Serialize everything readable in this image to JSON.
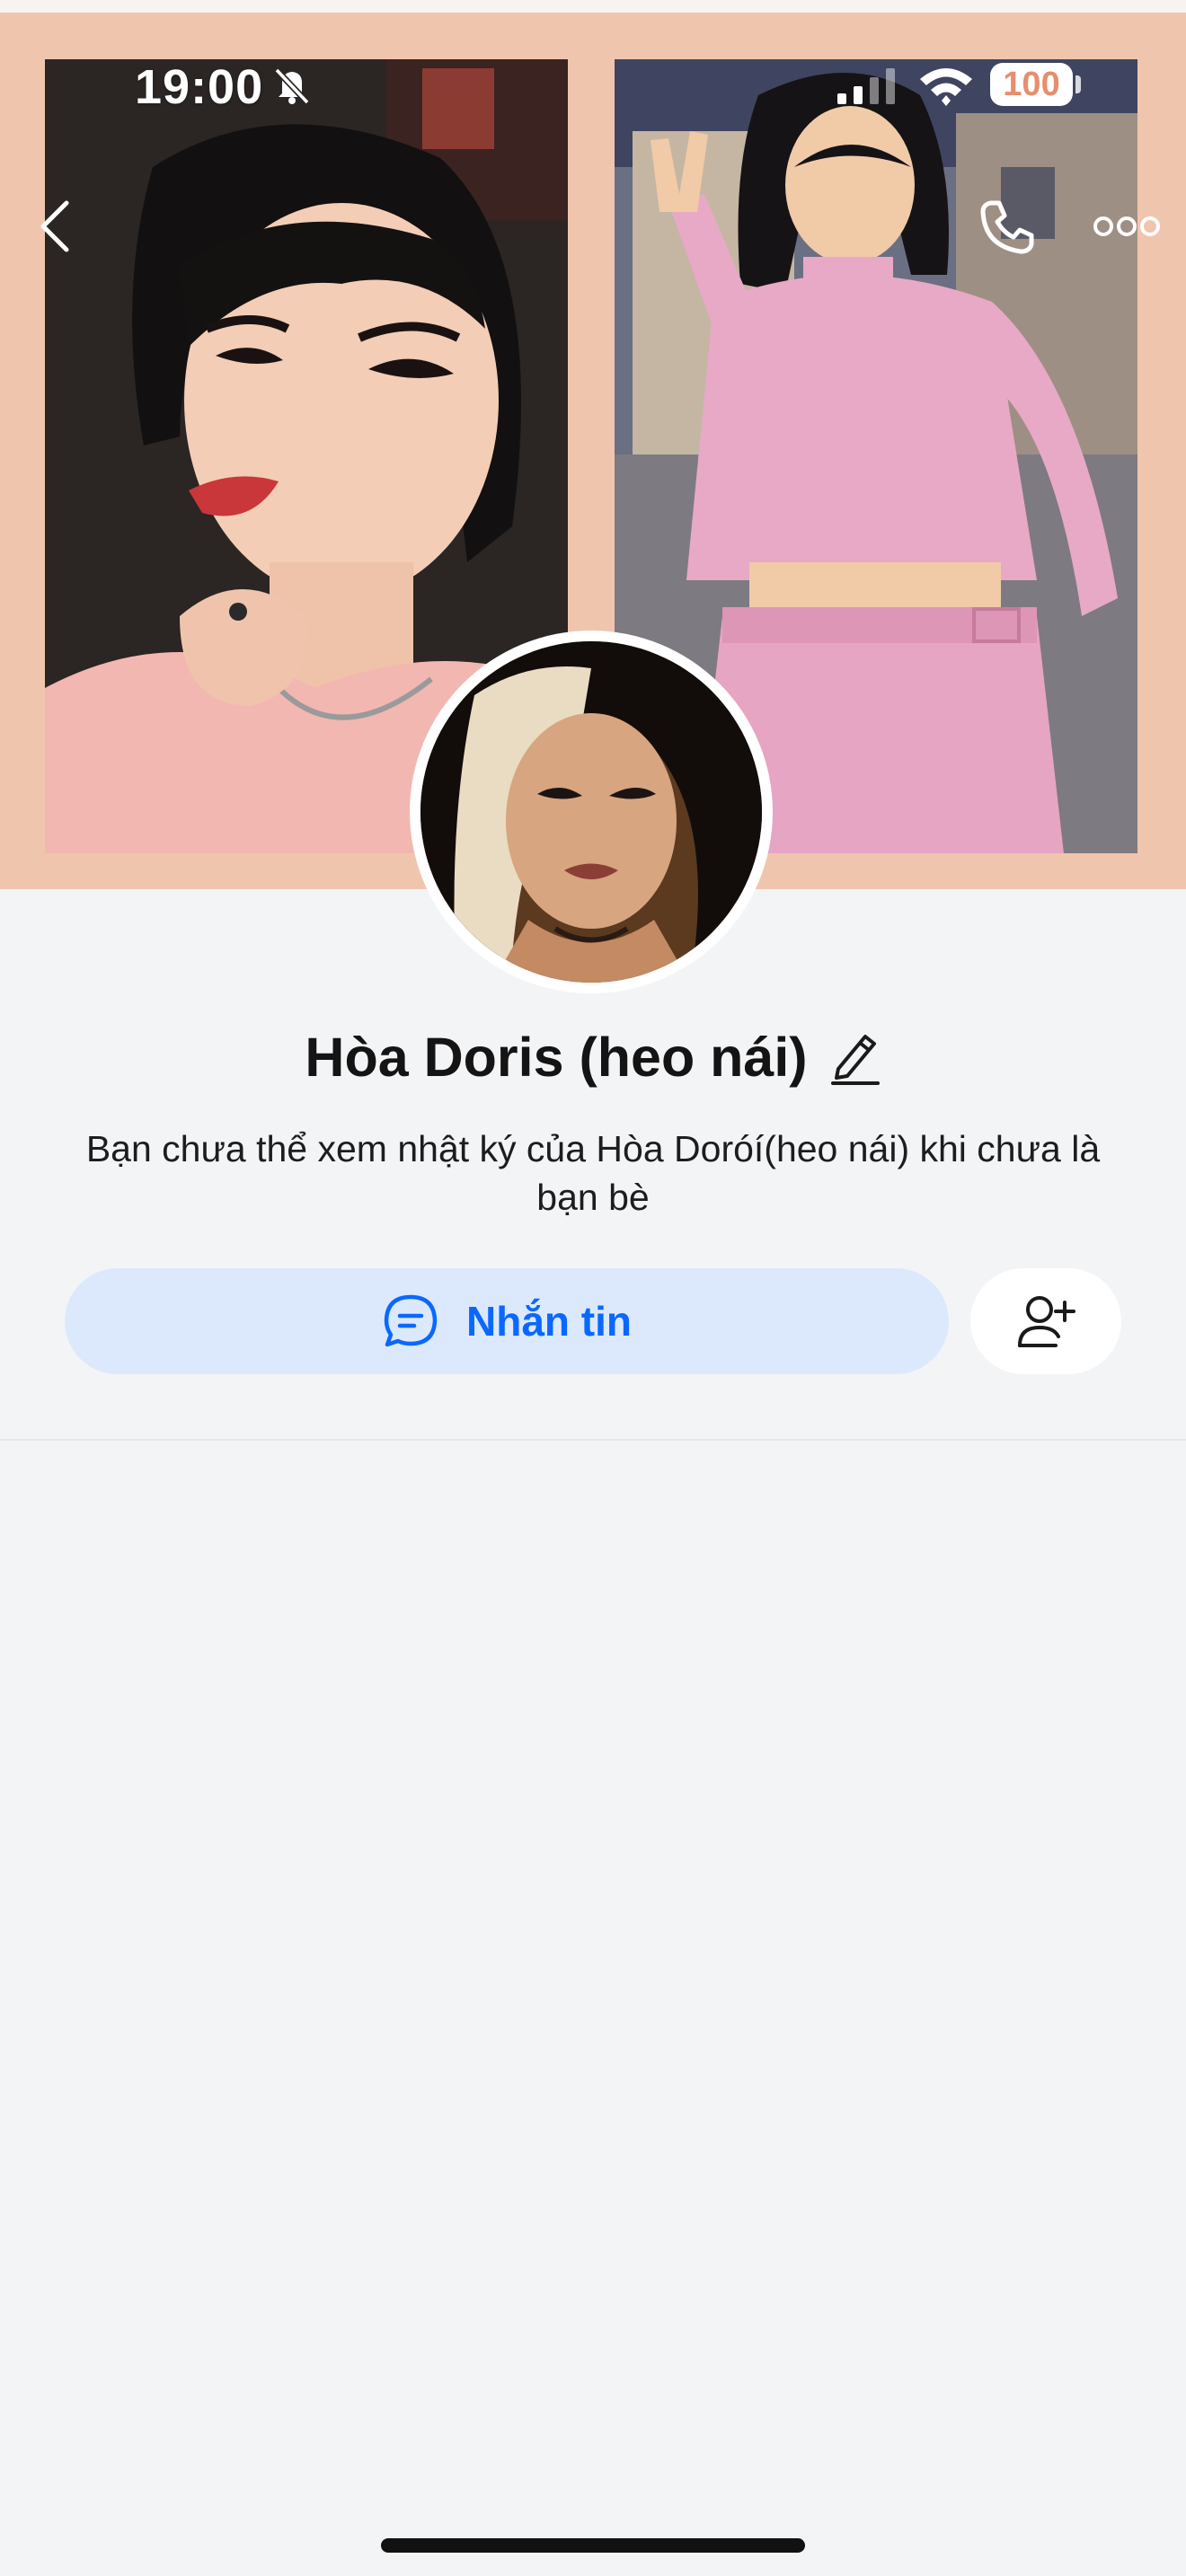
{
  "status_bar": {
    "time": "19:00",
    "battery": "100"
  },
  "profile": {
    "name": "Hòa Doris (heo nái)",
    "privacy_note": "Bạn chưa thể xem nhật ký của Hòa Doróí(heo nái) khi chưa là bạn bè"
  },
  "actions": {
    "message_label": "Nhắn tin"
  },
  "icons": {
    "back": "chevron-left-icon",
    "call": "phone-icon",
    "more": "more-horizontal-icon",
    "edit": "pencil-icon",
    "message": "chat-bubble-icon",
    "add_friend": "add-user-icon"
  },
  "colors": {
    "accent": "#0a68ff",
    "message_button_bg": "#dce9fd",
    "cover_bg": "#f0c5ae",
    "page_bg": "#f3f4f6"
  }
}
